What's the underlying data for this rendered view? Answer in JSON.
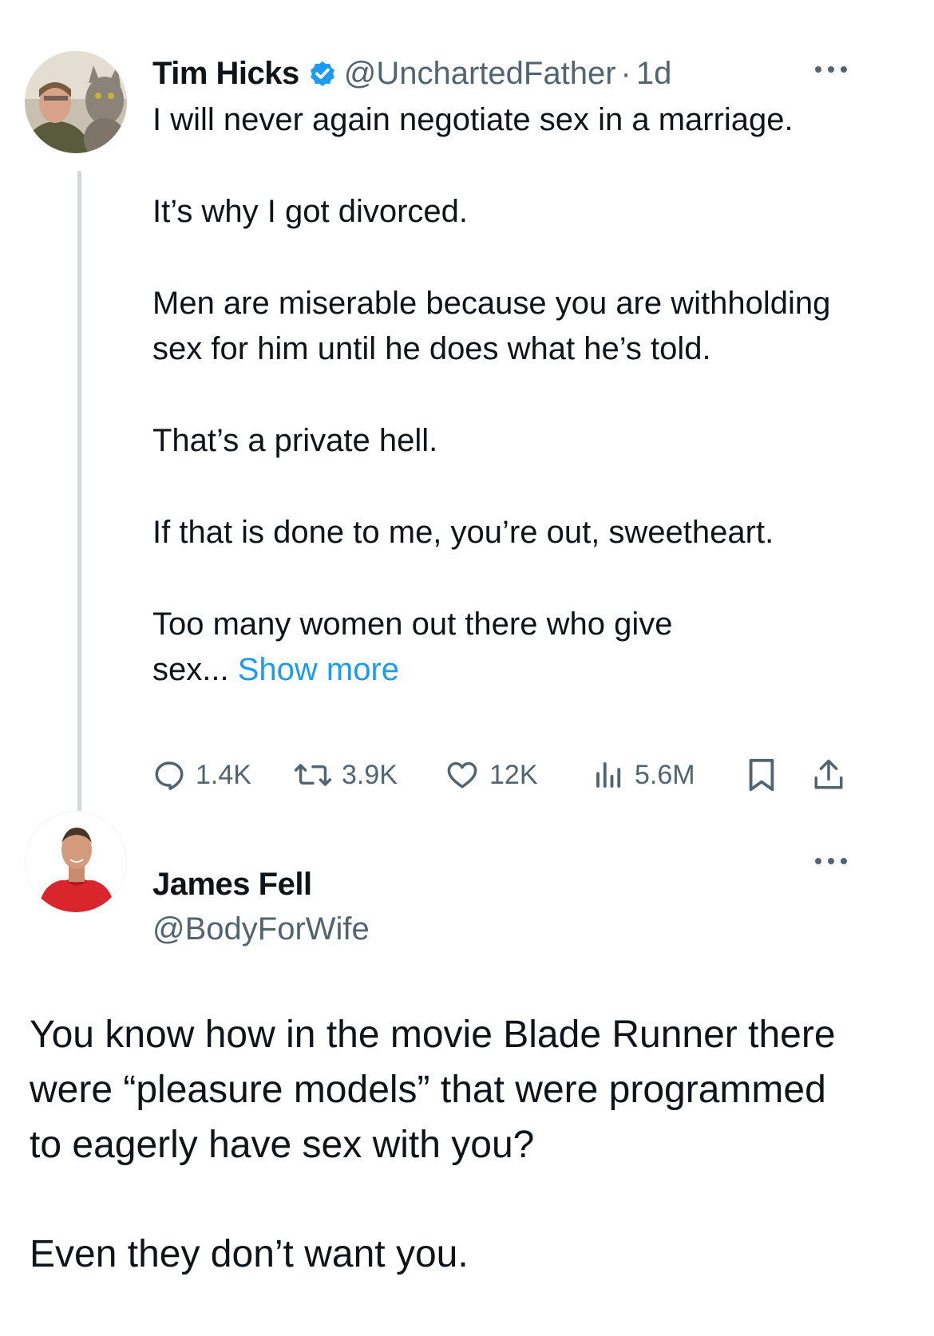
{
  "tweet1": {
    "author_name": "Tim Hicks",
    "handle": "@UnchartedFather",
    "separator": "·",
    "time": "1d",
    "verified": true,
    "paragraphs": [
      "I will never again negotiate sex in a marriage.",
      "It’s why I got divorced.",
      "Men are miserable because you are withholding sex for him until he does what he’s told.",
      "That’s a private hell.",
      "If that is done to me, you’re out, sweetheart.",
      "Too many women out there who give sex..."
    ],
    "show_more_label": "Show more",
    "stats": {
      "replies": "1.4K",
      "reposts": "3.9K",
      "likes": "12K",
      "views": "5.6M"
    }
  },
  "tweet2": {
    "author_name": "James Fell",
    "handle": "@BodyForWife",
    "paragraphs": [
      "You know how in the movie Blade Runner there were “pleasure models” that were programmed to eagerly have sex with you?",
      "Even they don’t want you."
    ]
  },
  "colors": {
    "text": "#0f1419",
    "secondary_text": "#536471",
    "link": "#1d9bf0",
    "verified_badge": "#1d9bf0",
    "thread_line": "#cfd9de"
  },
  "icons": {
    "reply": "reply-icon",
    "repost": "repost-icon",
    "like": "heart-icon",
    "views": "views-icon",
    "bookmark": "bookmark-icon",
    "share": "share-icon",
    "more": "more-icon",
    "verified": "verified-badge-icon"
  }
}
